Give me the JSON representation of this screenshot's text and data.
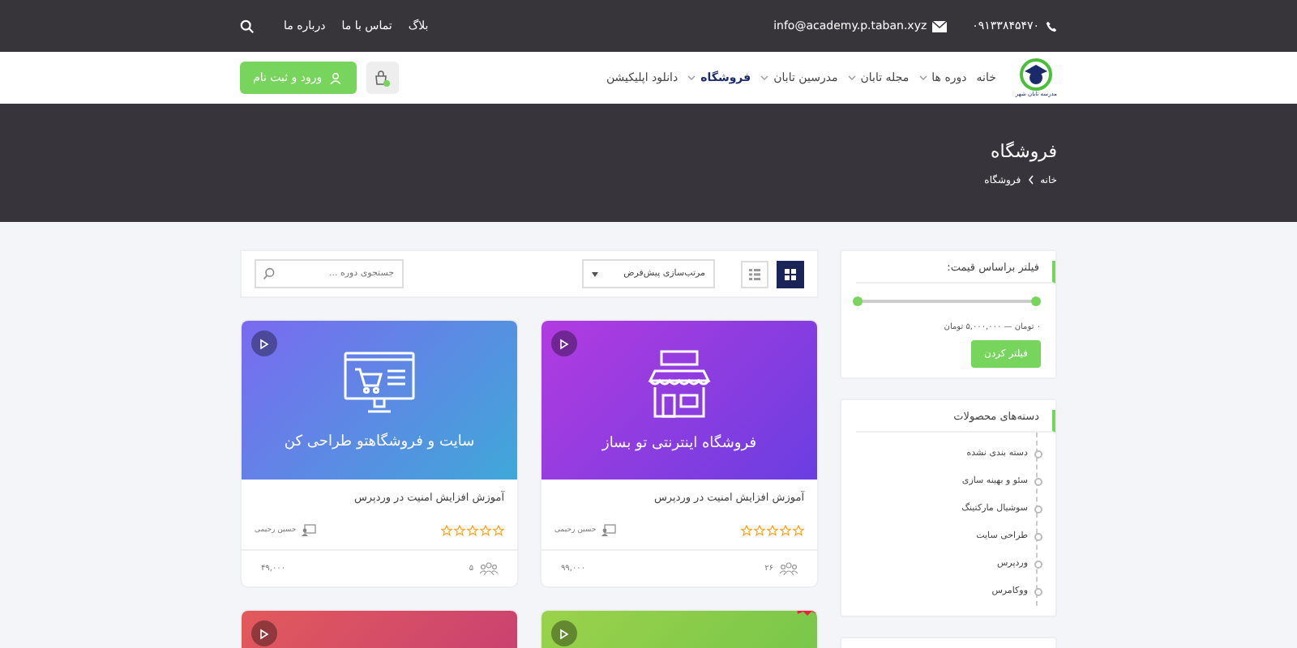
{
  "top_bar": {
    "phone": "۰۹۱۳۳۸۴۵۴۷۰",
    "email": "info@academy.p.taban.xyz",
    "links": [
      "بلاگ",
      "تماس با ما",
      "درباره ما"
    ]
  },
  "header": {
    "logo_text": "مدرسه تابان شهر",
    "nav": [
      {
        "label": "خانه",
        "caret": false,
        "selected": false
      },
      {
        "label": "دوره ها",
        "caret": true,
        "selected": false
      },
      {
        "label": "مجله تابان",
        "caret": true,
        "selected": false
      },
      {
        "label": "مدرسین تابان",
        "caret": true,
        "selected": false
      },
      {
        "label": "فروشگاه",
        "caret": true,
        "selected": true
      },
      {
        "label": "دانلود اپلیکیشن",
        "caret": false,
        "selected": false
      }
    ],
    "login_button": "ورود و ثبت نام"
  },
  "hero": {
    "title": "فروشگاه",
    "breadcrumb": [
      "خانه",
      "فروشگاه"
    ]
  },
  "sidebar": {
    "price_filter": {
      "title": "فیلتر براساس قیمت:",
      "level": 1,
      "range": "۰ تومان — ۵,۰۰۰,۰۰۰ تومان",
      "button": "فیلتر کردن"
    },
    "categories": {
      "title": "دسته‌های محصولات",
      "items": [
        "دسته بندی نشده",
        "سئو و بهینه سازی",
        "سوشیال مارکتینگ",
        "طراحی سایت",
        "وردپرس",
        "ووکامرس"
      ]
    }
  },
  "toolbar": {
    "views": [
      {
        "kind": "grid",
        "selected": true
      },
      {
        "kind": "list",
        "selected": false
      }
    ],
    "sort": "مرتب‌سازی پیش‌فرض",
    "search": {
      "placeholder": "جستجوی دوره ..."
    }
  },
  "products": [
    {
      "kind": "shop",
      "banner": "فروشگاه اینترنتی تو بساز",
      "title": "آموزش افزایش امنیت در وردپرس",
      "stars": 0,
      "instructor": "حسین رحیمی",
      "students": "۲۶",
      "price": "۹۹,۰۰۰",
      "badge": false
    },
    {
      "kind": "monitor",
      "banner": "سایت و فروشگاهتو طراحی کن",
      "title": "آموزش افزایش امنیت در وردپرس",
      "stars": 0,
      "instructor": "حسین رحیمی",
      "students": "۵",
      "price": "۴۹,۰۰۰",
      "badge": false
    },
    {
      "kind": "green",
      "badge": true
    },
    {
      "kind": "red",
      "badge": false
    }
  ]
}
